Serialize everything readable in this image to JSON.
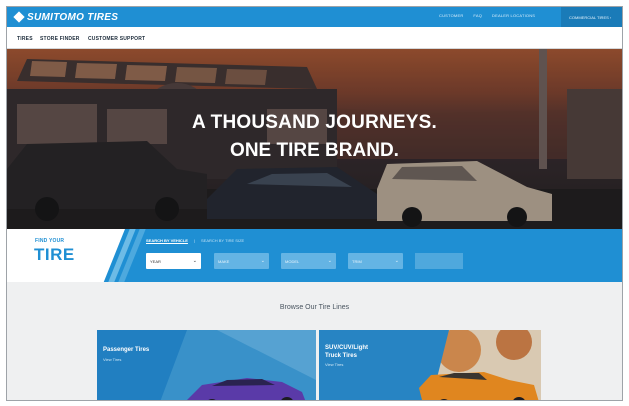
{
  "brand": {
    "name": "SUMITOMO TIRES"
  },
  "top_links": [
    "CUSTOMER",
    "FAQ",
    "DEALER LOCATIONS"
  ],
  "top_right_label": "COMMERCIAL TIRES",
  "main_nav": [
    "TIRES",
    "STORE FINDER",
    "CUSTOMER SUPPORT"
  ],
  "hero": {
    "line1": "A THOUSAND JOURNEYS.",
    "line2": "ONE TIRE BRAND."
  },
  "find_tire": {
    "label_small": "FIND YOUR",
    "label_big": "TIRE",
    "tab_active": "SEARCH BY VEHICLE",
    "tab_separator": "|",
    "tab_inactive": "SEARCH BY TIRE SIZE",
    "selects": [
      "YEAR",
      "MAKE",
      "MODEL",
      "TRIM"
    ]
  },
  "browse": {
    "title": "Browse Our Tire Lines",
    "cards": [
      {
        "title": "Passenger Tires",
        "subtitle": "View Tires"
      },
      {
        "title_line1": "SUV/CUV/Light",
        "title_line2": "Truck Tires",
        "subtitle": "View Tires"
      }
    ]
  },
  "colors": {
    "brand_blue": "#1f8fd3",
    "page_bg": "#f1f2f3"
  }
}
